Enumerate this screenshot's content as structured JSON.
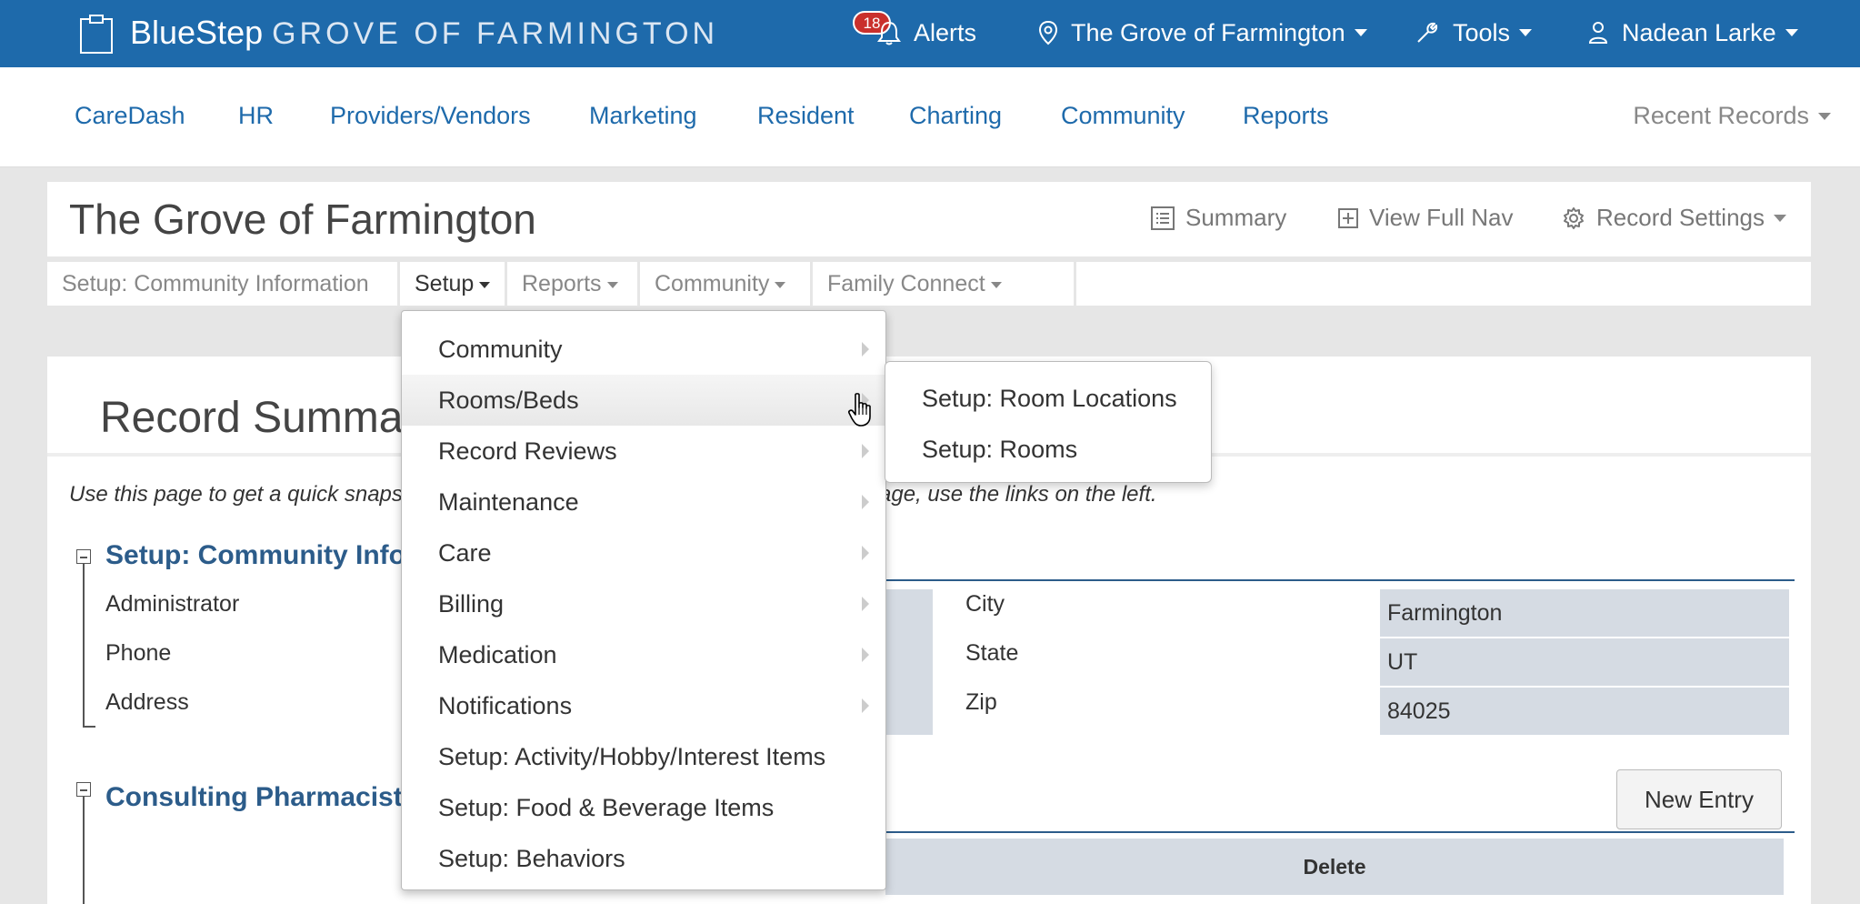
{
  "topbar": {
    "brand_main": "BlueStep",
    "brand_sub": "GROVE OF FARMINGTON",
    "alerts_count": "18",
    "alerts_label": "Alerts",
    "location_label": "The Grove of Farmington",
    "tools_label": "Tools",
    "user_label": "Nadean Larke"
  },
  "nav": {
    "items": [
      "CareDash",
      "HR",
      "Providers/Vendors",
      "Marketing",
      "Resident",
      "Charting",
      "Community",
      "Reports"
    ],
    "recent": "Recent Records"
  },
  "record": {
    "title": "The Grove of Farmington",
    "summary_link": "Summary",
    "full_nav_link": "View Full Nav",
    "settings_link": "Record Settings"
  },
  "subtabs": [
    "Setup: Community Information",
    "Setup",
    "Reports",
    "Community",
    "Family Connect"
  ],
  "main": {
    "summary_title": "Record Summary",
    "intro_left": "Use this page to get a quick snapsh",
    "intro_right": "age, use the links on the left.",
    "section1_title": "Setup: Community Info",
    "labels_left": [
      "Administrator",
      "Phone",
      "Address"
    ],
    "labels_right": [
      "City",
      "State",
      "Zip"
    ],
    "values_right": [
      "Farmington",
      "UT",
      "84025"
    ],
    "section2_title": "Consulting Pharmacist",
    "new_entry": "New Entry",
    "delete_header": "Delete"
  },
  "dropdown": {
    "items": [
      {
        "label": "Community",
        "submenu": true
      },
      {
        "label": "Rooms/Beds",
        "submenu": true
      },
      {
        "label": "Record Reviews",
        "submenu": true
      },
      {
        "label": "Maintenance",
        "submenu": true
      },
      {
        "label": "Care",
        "submenu": true
      },
      {
        "label": "Billing",
        "submenu": true
      },
      {
        "label": "Medication",
        "submenu": true
      },
      {
        "label": "Notifications",
        "submenu": true
      },
      {
        "label": "Setup: Activity/Hobby/Interest Items",
        "submenu": false
      },
      {
        "label": "Setup: Food & Beverage Items",
        "submenu": false
      },
      {
        "label": "Setup: Behaviors",
        "submenu": false
      }
    ],
    "submenu_items": [
      "Setup: Room Locations",
      "Setup: Rooms"
    ]
  },
  "colors": {
    "topbar": "#1e6aab",
    "link": "#1e6aab",
    "section_title": "#2c5c8a",
    "badge": "#c9302c",
    "field_bg": "#d5dbe3"
  }
}
